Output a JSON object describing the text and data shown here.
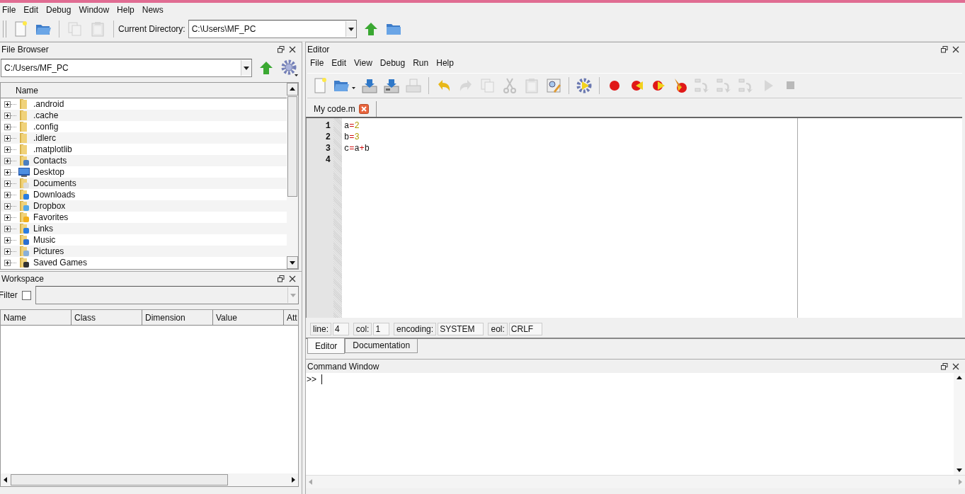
{
  "menu": [
    "File",
    "Edit",
    "Debug",
    "Window",
    "Help",
    "News"
  ],
  "toolbar": {
    "buttons": [
      {
        "kind": "new",
        "disabled": false
      },
      {
        "kind": "open",
        "disabled": false
      },
      {
        "kind": "copy",
        "disabled": true
      },
      {
        "kind": "paste",
        "disabled": true
      }
    ],
    "directory_label": "Current Directory:",
    "directory_value": "C:\\Users\\MF_PC"
  },
  "file_browser": {
    "title": "File Browser",
    "path": "C:/Users/MF_PC",
    "column": "Name",
    "items": [
      {
        "name": ".android",
        "kind": "folder",
        "expanded": false
      },
      {
        "name": ".cache",
        "kind": "folder",
        "expanded": false
      },
      {
        "name": ".config",
        "kind": "folder",
        "expanded": false
      },
      {
        "name": ".idlerc",
        "kind": "folder",
        "expanded": false
      },
      {
        "name": ".matplotlib",
        "kind": "folder",
        "expanded": false
      },
      {
        "name": "Contacts",
        "kind": "contacts",
        "expanded": false
      },
      {
        "name": "Desktop",
        "kind": "desktop",
        "expanded": false
      },
      {
        "name": "Documents",
        "kind": "documents",
        "expanded": false
      },
      {
        "name": "Downloads",
        "kind": "downloads",
        "expanded": false
      },
      {
        "name": "Dropbox",
        "kind": "dropbox",
        "expanded": false
      },
      {
        "name": "Favorites",
        "kind": "favorites",
        "expanded": false
      },
      {
        "name": "Links",
        "kind": "links",
        "expanded": false
      },
      {
        "name": "Music",
        "kind": "music",
        "expanded": false
      },
      {
        "name": "Pictures",
        "kind": "pictures",
        "expanded": false
      },
      {
        "name": "Saved Games",
        "kind": "games",
        "expanded": false
      }
    ]
  },
  "workspace": {
    "title": "Workspace",
    "filter_label": "Filter",
    "filter_checked": false,
    "columns": [
      "Name",
      "Class",
      "Dimension",
      "Value",
      "Att"
    ]
  },
  "editor": {
    "title": "Editor",
    "menu": [
      "File",
      "Edit",
      "View",
      "Debug",
      "Run",
      "Help"
    ],
    "toolbar": [
      {
        "kind": "new",
        "disabled": false
      },
      {
        "kind": "open",
        "disabled": false
      },
      {
        "kind": "save",
        "disabled": false
      },
      {
        "kind": "saveas",
        "disabled": false
      },
      {
        "kind": "print",
        "disabled": true
      },
      {
        "kind": "sep"
      },
      {
        "kind": "undo",
        "disabled": false
      },
      {
        "kind": "redo",
        "disabled": true
      },
      {
        "kind": "copy",
        "disabled": true
      },
      {
        "kind": "cut",
        "disabled": true
      },
      {
        "kind": "paste",
        "disabled": true
      },
      {
        "kind": "find",
        "disabled": false
      },
      {
        "kind": "sep"
      },
      {
        "kind": "rungear",
        "disabled": false
      },
      {
        "kind": "sep"
      },
      {
        "kind": "dot",
        "disabled": false
      },
      {
        "kind": "dotleft",
        "disabled": false
      },
      {
        "kind": "dotright",
        "disabled": false
      },
      {
        "kind": "broom",
        "disabled": false
      },
      {
        "kind": "stepin",
        "disabled": true
      },
      {
        "kind": "stepover",
        "disabled": true
      },
      {
        "kind": "stepout",
        "disabled": true
      },
      {
        "kind": "play",
        "disabled": true
      },
      {
        "kind": "stop",
        "disabled": true
      }
    ],
    "tab": "My code.m",
    "lines": [
      {
        "number": "1",
        "tokens": [
          {
            "kind": "ident",
            "text": "a"
          },
          {
            "kind": "op",
            "text": "="
          },
          {
            "kind": "num",
            "text": "2"
          }
        ]
      },
      {
        "number": "2",
        "tokens": [
          {
            "kind": "ident",
            "text": "b"
          },
          {
            "kind": "op",
            "text": "="
          },
          {
            "kind": "num",
            "text": "3"
          }
        ]
      },
      {
        "number": "3",
        "tokens": [
          {
            "kind": "ident",
            "text": "c"
          },
          {
            "kind": "op",
            "text": "="
          },
          {
            "kind": "ident",
            "text": "a"
          },
          {
            "kind": "op",
            "text": "+"
          },
          {
            "kind": "ident",
            "text": "b"
          }
        ]
      },
      {
        "number": "4"
      }
    ],
    "status": [
      {
        "label": "line:",
        "value": "4"
      },
      {
        "label": "col:",
        "value": "1"
      },
      {
        "label": "encoding:",
        "value": "SYSTEM"
      },
      {
        "label": "eol:",
        "value": "CRLF"
      }
    ],
    "bottom_tabs": [
      {
        "label": "Editor",
        "selected": true
      },
      {
        "label": "Documentation",
        "selected": false
      }
    ]
  },
  "command_window": {
    "title": "Command Window",
    "prompt": ">>"
  }
}
